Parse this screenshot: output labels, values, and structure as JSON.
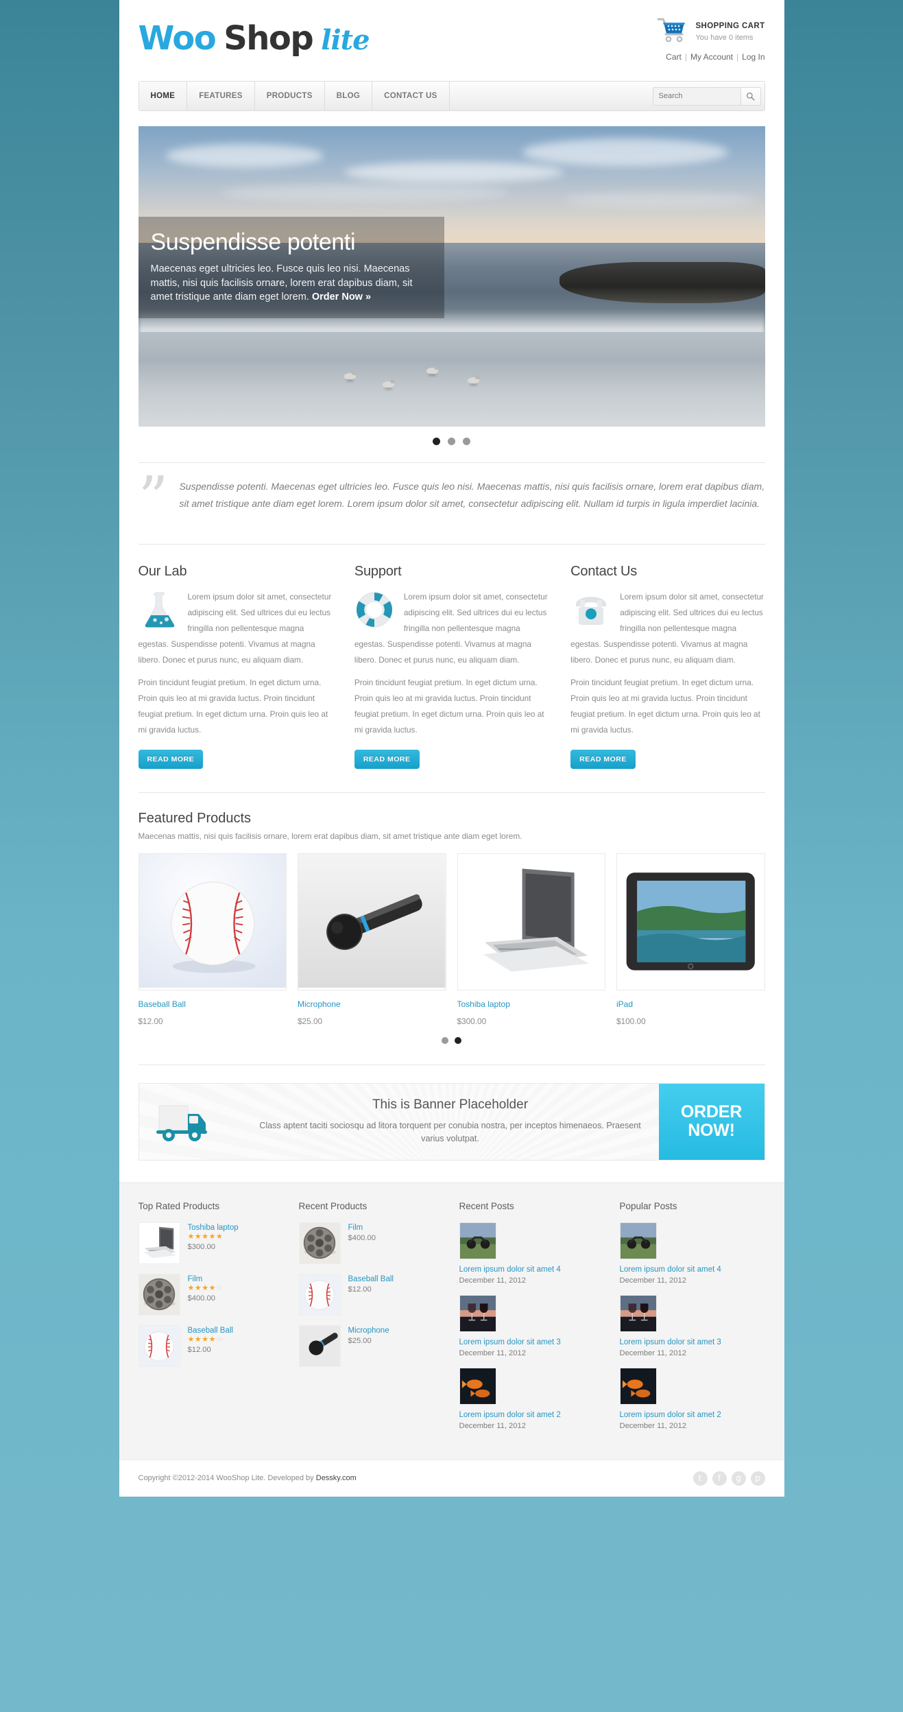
{
  "brand": {
    "woo": "Woo",
    "shop": "Shop",
    "lite": "lite"
  },
  "header": {
    "cart_icon": "shopping-cart-icon",
    "cart_title": "SHOPPING CART",
    "cart_subtitle": "You have 0 items",
    "links": [
      "Cart",
      "My Account",
      "Log In"
    ],
    "separator": "|"
  },
  "nav": {
    "items": [
      {
        "label": "HOME",
        "active": true
      },
      {
        "label": "FEATURES",
        "active": false
      },
      {
        "label": "PRODUCTS",
        "active": false
      },
      {
        "label": "BLOG",
        "active": false
      },
      {
        "label": "CONTACT US",
        "active": false
      }
    ],
    "search_placeholder": "Search",
    "search_value": "",
    "search_icon": "search-icon"
  },
  "hero": {
    "title": "Suspendisse potenti",
    "description": "Maecenas eget ultricies leo. Fusce quis leo nisi. Maecenas mattis, nisi quis facilisis ornare, lorem erat dapibus diam, sit amet tristique ante diam eget lorem. ",
    "cta": "Order Now »",
    "slides": 3,
    "active_slide": 1
  },
  "quote": {
    "mark": "”",
    "text": "Suspendisse potenti. Maecenas eget ultricies leo. Fusce quis leo nisi. Maecenas mattis, nisi quis facilisis ornare, lorem erat dapibus diam, sit amet tristique ante diam eget lorem. Lorem ipsum dolor sit amet, consectetur adipiscing elit. Nullam id turpis in ligula imperdiet lacinia."
  },
  "features": {
    "paragraph1": "Lorem ipsum dolor sit amet, consectetur adipiscing elit. Sed ultrices dui eu lectus fringilla non pellentesque magna egestas. Suspendisse potenti. Vivamus at magna libero. Donec et purus nunc, eu aliquam diam.",
    "paragraph2": "Proin tincidunt feugiat pretium. In eget dictum urna. Proin quis leo at mi gravida luctus. Proin tincidunt feugiat pretium. In eget dictum urna. Proin quis leo at mi gravida luctus.",
    "read_more": "READ MORE",
    "columns": [
      {
        "title": "Our Lab",
        "icon": "flask-icon"
      },
      {
        "title": "Support",
        "icon": "lifebuoy-icon"
      },
      {
        "title": "Contact Us",
        "icon": "telephone-icon"
      }
    ]
  },
  "featured_products": {
    "title": "Featured Products",
    "subtitle": "Maecenas mattis, nisi quis facilisis ornare, lorem erat dapibus diam, sit amet tristique ante diam eget lorem.",
    "items": [
      {
        "name": "Baseball Ball",
        "price": "$12.00",
        "image": "baseball-photo"
      },
      {
        "name": "Microphone",
        "price": "$25.00",
        "image": "microphone-photo"
      },
      {
        "name": "Toshiba laptop",
        "price": "$300.00",
        "image": "laptop-photo"
      },
      {
        "name": "iPad",
        "price": "$100.00",
        "image": "ipad-photo"
      }
    ],
    "slides": 2,
    "active_slide": 2
  },
  "banner": {
    "icon": "delivery-truck-icon",
    "heading": "This is Banner Placeholder",
    "text": "Class aptent taciti sociosqu ad litora torquent per conubia nostra, per inceptos himenaeos. Praesent varius volutpat.",
    "button": "ORDER NOW!"
  },
  "footer": {
    "top_rated": {
      "title": "Top Rated Products",
      "items": [
        {
          "name": "Toshiba laptop",
          "rating": 5,
          "price": "$300.00",
          "image": "laptop-photo"
        },
        {
          "name": "Film",
          "rating": 4,
          "price": "$400.00",
          "image": "filmreel-photo"
        },
        {
          "name": "Baseball Ball",
          "rating": 4,
          "price": "$12.00",
          "image": "baseball-photo"
        }
      ]
    },
    "recent_products": {
      "title": "Recent Products",
      "items": [
        {
          "name": "Film",
          "price": "$400.00",
          "image": "filmreel-photo"
        },
        {
          "name": "Baseball Ball",
          "price": "$12.00",
          "image": "baseball-photo"
        },
        {
          "name": "Microphone",
          "price": "$25.00",
          "image": "microphone-photo"
        }
      ]
    },
    "recent_posts": {
      "title": "Recent Posts",
      "items": [
        {
          "title": "Lorem ipsum dolor sit amet 4",
          "date": "December 11, 2012",
          "image": "motorcycle-photo"
        },
        {
          "title": "Lorem ipsum dolor sit amet 3",
          "date": "December 11, 2012",
          "image": "wineglasses-photo"
        },
        {
          "title": "Lorem ipsum dolor sit amet 2",
          "date": "December 11, 2012",
          "image": "goldfish-photo"
        }
      ]
    },
    "popular_posts": {
      "title": "Popular Posts",
      "items": [
        {
          "title": "Lorem ipsum dolor sit amet 4",
          "date": "December 11, 2012",
          "image": "motorcycle-photo"
        },
        {
          "title": "Lorem ipsum dolor sit amet 3",
          "date": "December 11, 2012",
          "image": "wineglasses-photo"
        },
        {
          "title": "Lorem ipsum dolor sit amet 2",
          "date": "December 11, 2012",
          "image": "goldfish-photo"
        }
      ]
    }
  },
  "copyright": {
    "text": "Copyright ©2012-2014 WooShop Lite. Developed by ",
    "developer": "Dessky.com",
    "socials": [
      {
        "name": "twitter-icon",
        "glyph": "t"
      },
      {
        "name": "facebook-icon",
        "glyph": "f"
      },
      {
        "name": "google-plus-icon",
        "glyph": "g"
      },
      {
        "name": "pinterest-icon",
        "glyph": "p"
      }
    ]
  },
  "colors": {
    "accent": "#29a8df",
    "teal": "#1a97b8",
    "page_bg": "#5ea6bb",
    "link": "#2596c4"
  }
}
